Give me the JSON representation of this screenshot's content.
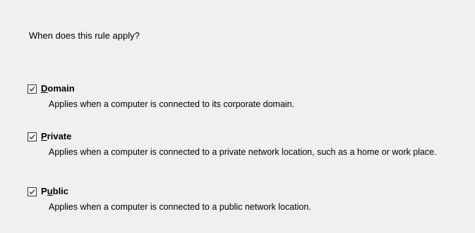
{
  "rule_scope": {
    "question": "When does this rule apply?"
  },
  "profiles": [
    {
      "label_mnemonic": "D",
      "label_rest": "omain",
      "checked": true,
      "description": "Applies when a computer is connected to its corporate domain."
    },
    {
      "label_mnemonic": "P",
      "label_rest": "rivate",
      "checked": true,
      "description": "Applies when a computer is connected to a private network location, such as a home or work place."
    },
    {
      "label_pre": "P",
      "label_mnemonic": "u",
      "label_rest": "blic",
      "checked": true,
      "description": "Applies when a computer is connected to a public network location."
    }
  ]
}
